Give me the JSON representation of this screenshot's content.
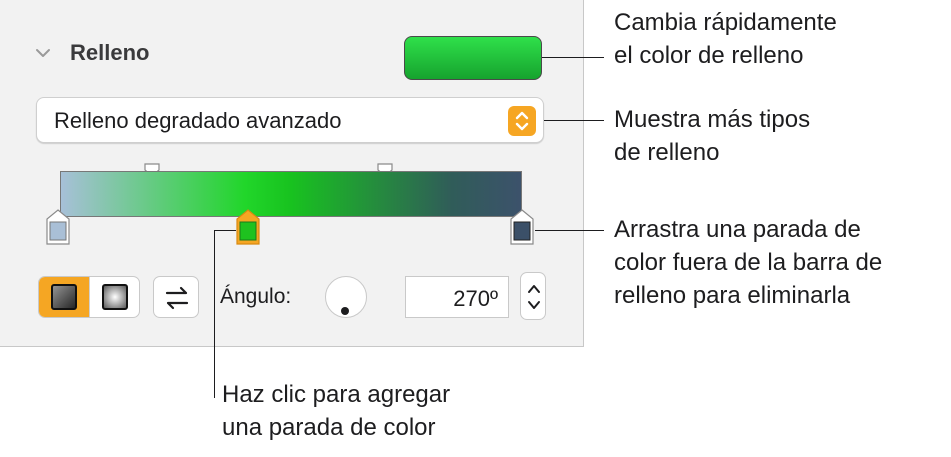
{
  "section": {
    "title": "Relleno",
    "fill_color": "#22c73a"
  },
  "fill_type": {
    "selected": "Relleno degradado avanzado",
    "accent": "#f5a623"
  },
  "gradient": {
    "colors": [
      "#a7c0d8",
      "#21d62a",
      "#3c526b"
    ],
    "stops": [
      {
        "color": "#a9bfd6",
        "selected": false
      },
      {
        "color": "#1ec21f",
        "selected": true
      },
      {
        "color": "#3b5068",
        "selected": false
      }
    ]
  },
  "angle": {
    "label": "Ángulo:",
    "value": "270º"
  },
  "callouts": {
    "fill_color_line1": "Cambia rápidamente",
    "fill_color_line2": "el color de relleno",
    "types_line1": "Muestra más tipos",
    "types_line2": "de relleno",
    "drag_line1": "Arrastra una parada de",
    "drag_line2": "color fuera de la barra de",
    "drag_line3": "relleno para eliminarla",
    "click_line1": "Haz clic para agregar",
    "click_line2": "una parada de color"
  }
}
